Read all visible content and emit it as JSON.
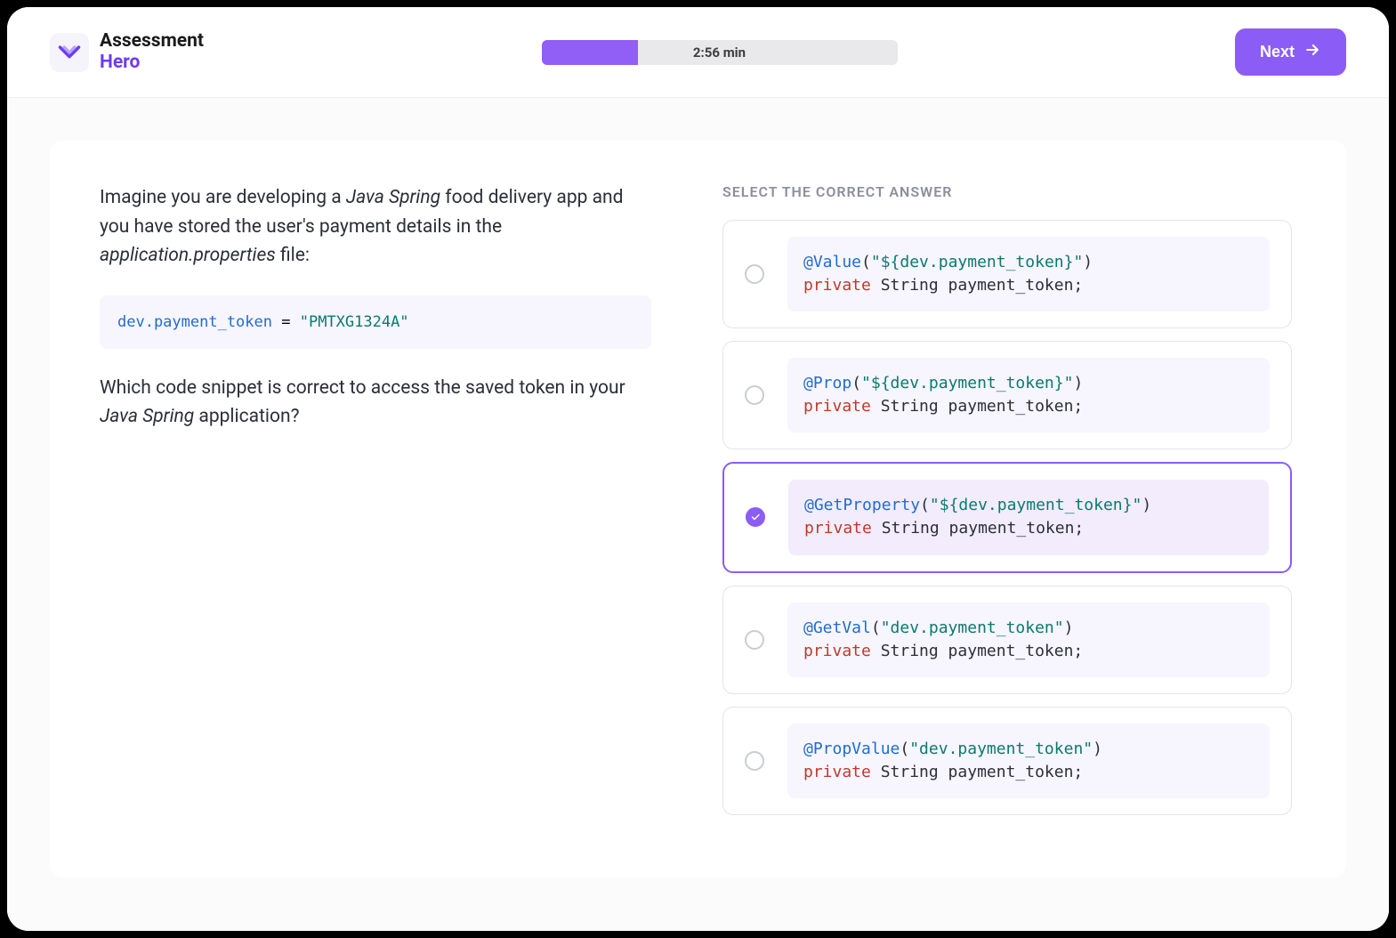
{
  "brand": {
    "line1": "Assessment",
    "line2": "Hero"
  },
  "timer": "2:56 min",
  "next_label": "Next",
  "question": {
    "p1_pre": "Imagine you are developing a ",
    "p1_italic1": "Java Spring",
    "p1_mid": " food delivery app and you have stored the user's payment details in the ",
    "p1_italic2": "application.properties",
    "p1_post": " file:",
    "code_key": "dev.payment_token",
    "code_eq": " = ",
    "code_val": "\"PMTXG1324A\"",
    "p2_pre": "Which code snippet is correct to access the saved token in your ",
    "p2_italic": "Java Spring",
    "p2_post": " application?"
  },
  "answers_title": "SELECT THE CORRECT ANSWER",
  "answers": [
    {
      "annot": "@Value",
      "paren_open": "(",
      "arg": "\"${dev.payment_token}\"",
      "paren_close": ")",
      "priv": "private",
      "rest": " String payment_token;",
      "selected": false
    },
    {
      "annot": "@Prop",
      "paren_open": "(",
      "arg": "\"${dev.payment_token}\"",
      "paren_close": ")",
      "priv": "private",
      "rest": " String payment_token;",
      "selected": false
    },
    {
      "annot": "@GetProperty",
      "paren_open": "(",
      "arg": "\"${dev.payment_token}\"",
      "paren_close": ")",
      "priv": "private",
      "rest": " String payment_token;",
      "selected": true
    },
    {
      "annot": "@GetVal",
      "paren_open": "(",
      "arg": "\"dev.payment_token\"",
      "paren_close": ")",
      "priv": "private",
      "rest": " String payment_token;",
      "selected": false
    },
    {
      "annot": "@PropValue",
      "paren_open": "(",
      "arg": "\"dev.payment_token\"",
      "paren_close": ")",
      "priv": "private",
      "rest": " String payment_token;",
      "selected": false
    }
  ]
}
